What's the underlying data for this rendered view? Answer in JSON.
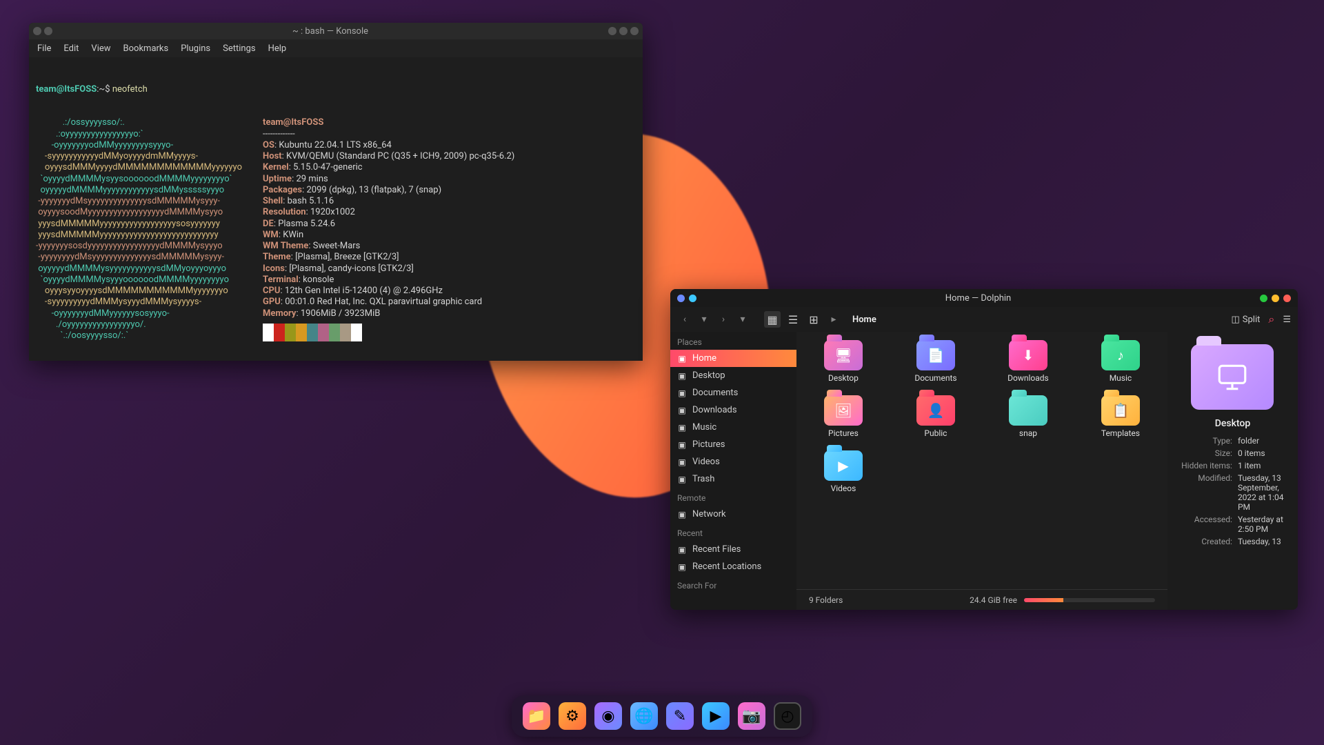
{
  "konsole": {
    "title": "~ : bash — Konsole",
    "menu": [
      "File",
      "Edit",
      "View",
      "Bookmarks",
      "Plugins",
      "Settings",
      "Help"
    ],
    "prompt_user": "team@ItsFOSS",
    "prompt_path": ":~$",
    "command": "neofetch",
    "ascii": [
      ".:/ossyyyysso/:.",
      ".:oyyyyyyyyyyyyyyyyo:`",
      "-oyyyyyyyodMMyyyyyyyysyyyo-",
      "-syyyyyyyyyyydMMyoyyyydmMMyyyys-",
      "oyyysdMMMyyyydMMMMMMMMMMMMyyyyyyo",
      "`oyyyydMMMMysyysoooooodMMMMyyyyyyyyo`",
      "oyyyyydMMMMyyyyyyyyyyyysdMMysssssyyyo",
      "-yyyyyyydMsyyyyyyyyyyyyyysdMMMMMysyyy-",
      "oyyyysoodMyyyyyyyyyyyyyyyyyydMMMMysyyo",
      "yyysdMMMMMyyyyyyyyyyyyyyyyyysosyyyyyyy",
      "yyysdMMMMMyyyyyyyyyyyyyyyyyyyyyyyyyyyy",
      "-yyyyyyysosdyyyyyyyyyyyyyyyyydMMMMysyyyo",
      "-yyyyyyyydMsyyyyyyyyyyyyyysdMMMMMysyyy-",
      "oyyyyydMMMMysyyyyyyyyyyysdMMyoyyyoyyyo",
      "`oyyyydMMMMysyyyoooooodMMMMyyyyyyyyo",
      "oyyysyyoyyyysdMMMMMMMMMMMyyyyyyyo",
      "-syyyyyyyyydMMMysyyydMMMysyyyys-",
      "-oyyyyyyydMMyyyyyysosyyyo-",
      "./oyyyyyyyyyyyyyyyyo/.",
      "`.:/oosyyyysso/:.`"
    ],
    "neofetch": {
      "title": "team@ItsFOSS",
      "sep": "-------------",
      "rows": [
        {
          "k": "OS",
          "v": "Kubuntu 22.04.1 LTS x86_64"
        },
        {
          "k": "Host",
          "v": "KVM/QEMU (Standard PC (Q35 + ICH9, 2009) pc-q35-6.2)"
        },
        {
          "k": "Kernel",
          "v": "5.15.0-47-generic"
        },
        {
          "k": "Uptime",
          "v": "29 mins"
        },
        {
          "k": "Packages",
          "v": "2099 (dpkg), 13 (flatpak), 7 (snap)"
        },
        {
          "k": "Shell",
          "v": "bash 5.1.16"
        },
        {
          "k": "Resolution",
          "v": "1920x1002"
        },
        {
          "k": "DE",
          "v": "Plasma 5.24.6"
        },
        {
          "k": "WM",
          "v": "KWin"
        },
        {
          "k": "WM Theme",
          "v": "Sweet-Mars"
        },
        {
          "k": "Theme",
          "v": "[Plasma], Breeze [GTK2/3]"
        },
        {
          "k": "Icons",
          "v": "[Plasma], candy-icons [GTK2/3]"
        },
        {
          "k": "Terminal",
          "v": "konsole"
        },
        {
          "k": "CPU",
          "v": "12th Gen Intel i5-12400 (4) @ 2.496GHz"
        },
        {
          "k": "GPU",
          "v": "00:01.0 Red Hat, Inc. QXL paravirtual graphic card"
        },
        {
          "k": "Memory",
          "v": "1906MiB / 3923MiB"
        }
      ],
      "swatches": [
        "#ffffff",
        "#cc241d",
        "#98971a",
        "#d79921",
        "#458588",
        "#b16286",
        "#689d6a",
        "#a89984",
        "#ffffff"
      ]
    }
  },
  "dolphin": {
    "title": "Home — Dolphin",
    "breadcrumb": "Home",
    "split_label": "Split",
    "sidebar": {
      "places_head": "Places",
      "places": [
        {
          "icon": "home-icon",
          "label": "Home",
          "active": true
        },
        {
          "icon": "desktop-icon",
          "label": "Desktop"
        },
        {
          "icon": "documents-icon",
          "label": "Documents"
        },
        {
          "icon": "downloads-icon",
          "label": "Downloads"
        },
        {
          "icon": "music-icon",
          "label": "Music"
        },
        {
          "icon": "pictures-icon",
          "label": "Pictures"
        },
        {
          "icon": "videos-icon",
          "label": "Videos"
        },
        {
          "icon": "trash-icon",
          "label": "Trash"
        }
      ],
      "remote_head": "Remote",
      "remote": [
        {
          "icon": "network-icon",
          "label": "Network"
        }
      ],
      "recent_head": "Recent",
      "recent": [
        {
          "icon": "recent-files-icon",
          "label": "Recent Files"
        },
        {
          "icon": "recent-locations-icon",
          "label": "Recent Locations"
        }
      ],
      "search_head": "Search For"
    },
    "folders": [
      {
        "name": "Desktop",
        "cls": "fc-pink",
        "glyph": "🖥"
      },
      {
        "name": "Documents",
        "cls": "fc-blue",
        "glyph": "📄"
      },
      {
        "name": "Downloads",
        "cls": "fc-pink2",
        "glyph": "⬇"
      },
      {
        "name": "Music",
        "cls": "fc-green",
        "glyph": "♪"
      },
      {
        "name": "Pictures",
        "cls": "fc-mix",
        "glyph": "🖼"
      },
      {
        "name": "Public",
        "cls": "fc-red",
        "glyph": "👤"
      },
      {
        "name": "snap",
        "cls": "fc-teal",
        "glyph": ""
      },
      {
        "name": "Templates",
        "cls": "fc-yel",
        "glyph": "📋"
      },
      {
        "name": "Videos",
        "cls": "fc-cyan",
        "glyph": "▶"
      }
    ],
    "details": {
      "name": "Desktop",
      "meta": [
        {
          "k": "Type:",
          "v": "folder"
        },
        {
          "k": "Size:",
          "v": "0 items"
        },
        {
          "k": "Hidden items:",
          "v": "1 item"
        },
        {
          "k": "Modified:",
          "v": "Tuesday, 13 September, 2022 at 1:04 PM"
        },
        {
          "k": "Accessed:",
          "v": "Yesterday at 2:50 PM"
        },
        {
          "k": "Created:",
          "v": "Tuesday, 13"
        }
      ]
    },
    "status": {
      "folders": "9 Folders",
      "disk": "24.4 GiB free"
    }
  },
  "dock": [
    {
      "name": "files-app",
      "cls": "da1",
      "glyph": "📁"
    },
    {
      "name": "settings-app",
      "cls": "da2",
      "glyph": "⚙"
    },
    {
      "name": "media-app",
      "cls": "da3",
      "glyph": "◉"
    },
    {
      "name": "browser-app",
      "cls": "da4",
      "glyph": "🌐"
    },
    {
      "name": "editor-app",
      "cls": "da5",
      "glyph": "✎"
    },
    {
      "name": "terminal-app",
      "cls": "da6",
      "glyph": "▶"
    },
    {
      "name": "screenshot-app",
      "cls": "da7",
      "glyph": "📷"
    },
    {
      "name": "clock-app",
      "cls": "da8",
      "glyph": "◴"
    }
  ]
}
